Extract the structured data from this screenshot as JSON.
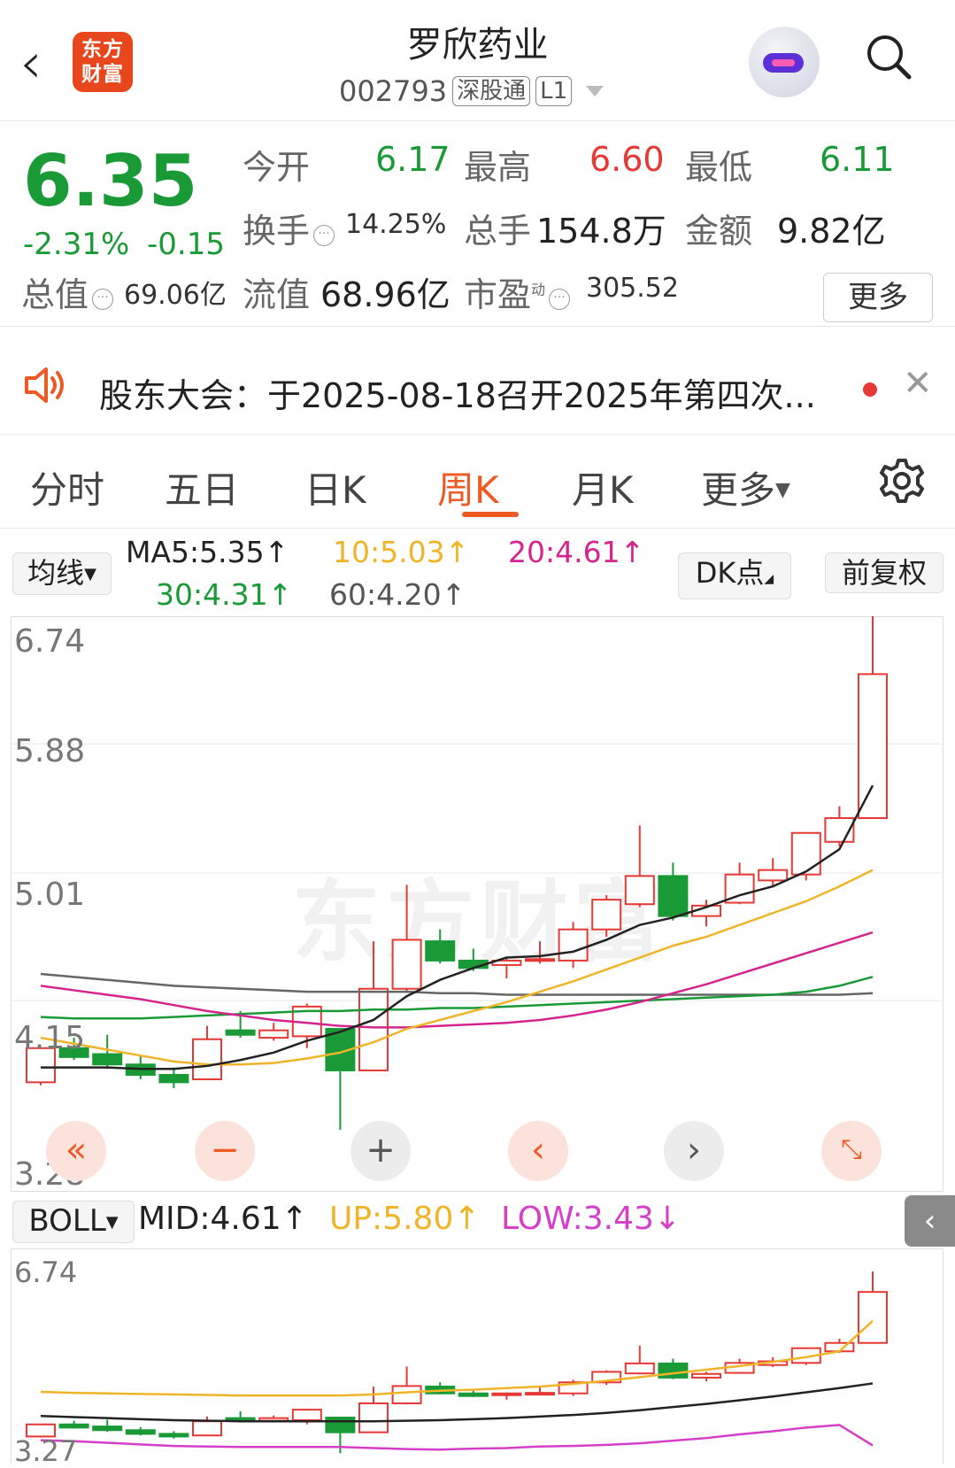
{
  "header": {
    "back": "‹",
    "logo_line1": "东方",
    "logo_line2": "财富",
    "title": "罗欣药业",
    "code": "002793",
    "tag1": "深股通",
    "tag2": "L1"
  },
  "quote": {
    "price": "6.35",
    "pct": "-2.31%",
    "chg": "-0.15",
    "open_label": "今开",
    "open": "6.17",
    "high_label": "最高",
    "high": "6.60",
    "low_label": "最低",
    "low": "6.11",
    "turnover_label": "换手",
    "turnover": "14.25%",
    "volume_label": "总手",
    "volume": "154.8万",
    "amount_label": "金额",
    "amount": "9.82亿",
    "mktcap_label": "总值",
    "mktcap": "69.06亿",
    "float_label": "流值",
    "float": "68.96亿",
    "pe_label": "市盈",
    "pe_sup": "动",
    "pe": "305.52",
    "more": "更多"
  },
  "notice": {
    "text": "股东大会：于2025-08-18召开2025年第四次..."
  },
  "tabs": [
    "分时",
    "五日",
    "日K",
    "周K",
    "月K",
    "更多"
  ],
  "active_tab": "周K",
  "ma_bar": {
    "selector": "均线",
    "ma5": "MA5:5.35↑",
    "ma10": "10:5.03↑",
    "ma20": "20:4.61↑",
    "ma30": "30:4.31↑",
    "ma60": "60:4.20↑",
    "dk": "DK点",
    "adjust": "前复权"
  },
  "boll_bar": {
    "selector": "BOLL",
    "mid": "MID:4.61↑",
    "up": "UP:5.80↑",
    "low": "LOW:3.43↓"
  },
  "colors": {
    "up": "#e53935",
    "down": "#1a9a36",
    "accent": "#ee5a24",
    "ma5": "#222222",
    "ma10": "#f0b429",
    "ma20": "#d4258e",
    "ma30": "#1a9a36",
    "ma60": "#666666"
  },
  "chart_data": {
    "type": "candlestick",
    "y_ticks": [
      "6.74",
      "5.88",
      "5.01",
      "4.15",
      "3.28"
    ],
    "ylim": [
      3.28,
      6.74
    ],
    "candles": [
      {
        "o": 3.6,
        "c": 3.83,
        "h": 3.83,
        "l": 3.58
      },
      {
        "o": 3.83,
        "c": 3.77,
        "h": 3.9,
        "l": 3.75
      },
      {
        "o": 3.79,
        "c": 3.72,
        "h": 3.92,
        "l": 3.69
      },
      {
        "o": 3.72,
        "c": 3.65,
        "h": 3.78,
        "l": 3.62
      },
      {
        "o": 3.65,
        "c": 3.6,
        "h": 3.7,
        "l": 3.56
      },
      {
        "o": 3.62,
        "c": 3.89,
        "h": 3.98,
        "l": 3.62
      },
      {
        "o": 3.95,
        "c": 3.92,
        "h": 4.08,
        "l": 3.9
      },
      {
        "o": 3.9,
        "c": 3.95,
        "h": 4.0,
        "l": 3.88
      },
      {
        "o": 3.91,
        "c": 4.11,
        "h": 4.13,
        "l": 3.83
      },
      {
        "o": 3.96,
        "c": 3.68,
        "h": 3.96,
        "l": 3.28
      },
      {
        "o": 3.68,
        "c": 4.23,
        "h": 4.55,
        "l": 3.68
      },
      {
        "o": 4.23,
        "c": 4.56,
        "h": 4.93,
        "l": 4.21
      },
      {
        "o": 4.55,
        "c": 4.42,
        "h": 4.63,
        "l": 4.4
      },
      {
        "o": 4.42,
        "c": 4.37,
        "h": 4.5,
        "l": 4.35
      },
      {
        "o": 4.39,
        "c": 4.42,
        "h": 4.44,
        "l": 4.3
      },
      {
        "o": 4.42,
        "c": 4.43,
        "h": 4.55,
        "l": 4.4
      },
      {
        "o": 4.42,
        "c": 4.63,
        "h": 4.68,
        "l": 4.37
      },
      {
        "o": 4.63,
        "c": 4.83,
        "h": 4.86,
        "l": 4.58
      },
      {
        "o": 4.8,
        "c": 4.99,
        "h": 5.33,
        "l": 4.78
      },
      {
        "o": 4.99,
        "c": 4.72,
        "h": 5.08,
        "l": 4.69
      },
      {
        "o": 4.72,
        "c": 4.79,
        "h": 4.83,
        "l": 4.65
      },
      {
        "o": 4.81,
        "c": 5.0,
        "h": 5.08,
        "l": 4.8
      },
      {
        "o": 4.96,
        "c": 5.03,
        "h": 5.11,
        "l": 4.92
      },
      {
        "o": 5.0,
        "c": 5.28,
        "h": 5.28,
        "l": 4.96
      },
      {
        "o": 5.22,
        "c": 5.38,
        "h": 5.46,
        "l": 5.19
      },
      {
        "o": 5.38,
        "c": 6.35,
        "h": 6.74,
        "l": 5.38
      }
    ],
    "ma5": [
      3.7,
      3.7,
      3.7,
      3.69,
      3.69,
      3.71,
      3.75,
      3.8,
      3.88,
      3.94,
      4.02,
      4.18,
      4.29,
      4.37,
      4.44,
      4.45,
      4.48,
      4.56,
      4.66,
      4.71,
      4.78,
      4.86,
      4.92,
      5.02,
      5.17,
      5.6
    ],
    "ma10": [
      3.9,
      3.86,
      3.82,
      3.78,
      3.74,
      3.72,
      3.72,
      3.73,
      3.76,
      3.8,
      3.87,
      3.96,
      4.02,
      4.08,
      4.14,
      4.21,
      4.28,
      4.36,
      4.44,
      4.52,
      4.58,
      4.66,
      4.74,
      4.82,
      4.92,
      5.03
    ],
    "ma20": [
      4.25,
      4.22,
      4.19,
      4.16,
      4.12,
      4.08,
      4.05,
      4.02,
      4.0,
      3.98,
      3.97,
      3.97,
      3.98,
      3.99,
      4.0,
      4.02,
      4.05,
      4.09,
      4.14,
      4.2,
      4.26,
      4.33,
      4.4,
      4.47,
      4.54,
      4.61
    ],
    "ma30": [
      4.04,
      4.03,
      4.03,
      4.03,
      4.04,
      4.05,
      4.06,
      4.07,
      4.08,
      4.08,
      4.09,
      4.09,
      4.1,
      4.1,
      4.11,
      4.12,
      4.13,
      4.14,
      4.15,
      4.16,
      4.17,
      4.18,
      4.19,
      4.21,
      4.25,
      4.31
    ],
    "ma60": [
      4.33,
      4.31,
      4.29,
      4.27,
      4.25,
      4.24,
      4.23,
      4.22,
      4.21,
      4.21,
      4.21,
      4.21,
      4.2,
      4.2,
      4.19,
      4.19,
      4.19,
      4.19,
      4.19,
      4.19,
      4.19,
      4.19,
      4.19,
      4.19,
      4.19,
      4.2
    ],
    "boll_y_ticks": [
      "6.74",
      "3.27"
    ],
    "boll_ylim": [
      3.27,
      6.74
    ],
    "boll_up": [
      4.45,
      4.43,
      4.42,
      4.41,
      4.4,
      4.39,
      4.38,
      4.38,
      4.38,
      4.38,
      4.4,
      4.44,
      4.47,
      4.49,
      4.52,
      4.55,
      4.6,
      4.66,
      4.73,
      4.8,
      4.87,
      4.94,
      5.02,
      5.11,
      5.22,
      5.8
    ],
    "boll_mid": [
      3.99,
      3.97,
      3.95,
      3.93,
      3.91,
      3.9,
      3.89,
      3.89,
      3.89,
      3.89,
      3.89,
      3.9,
      3.91,
      3.93,
      3.95,
      3.98,
      4.01,
      4.05,
      4.1,
      4.16,
      4.22,
      4.29,
      4.36,
      4.44,
      4.52,
      4.61
    ],
    "boll_low": [
      3.53,
      3.51,
      3.48,
      3.45,
      3.42,
      3.41,
      3.4,
      3.4,
      3.4,
      3.4,
      3.38,
      3.36,
      3.35,
      3.37,
      3.38,
      3.41,
      3.42,
      3.44,
      3.47,
      3.52,
      3.57,
      3.64,
      3.7,
      3.77,
      3.82,
      3.43
    ]
  }
}
